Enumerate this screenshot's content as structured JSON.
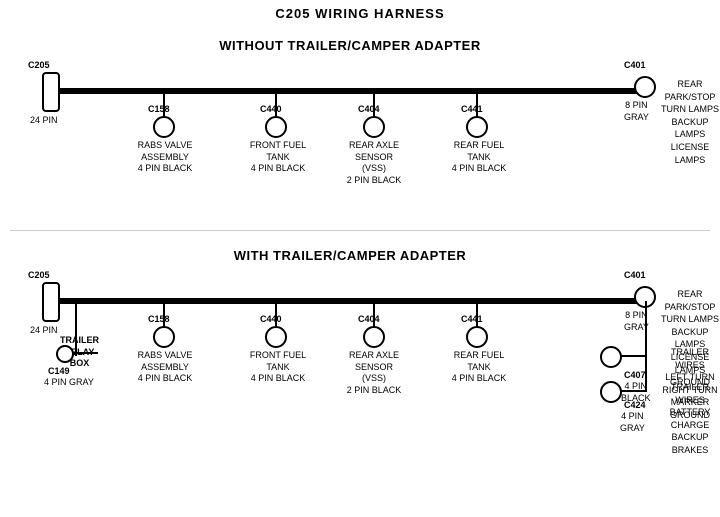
{
  "title": "C205 WIRING HARNESS",
  "section1": {
    "label": "WITHOUT  TRAILER/CAMPER  ADAPTER",
    "connectors": {
      "left": {
        "id": "C205",
        "sub": "24 PIN",
        "type": "rect"
      },
      "right": {
        "id": "C401",
        "sub": "8 PIN\nGRAY",
        "desc": "REAR PARK/STOP\nTURN LAMPS\nBACKUP LAMPS\nLICENSE LAMPS",
        "type": "circle"
      },
      "c158": {
        "id": "C158",
        "desc": "RABS VALVE\nASSEMBLY\n4 PIN BLACK"
      },
      "c440": {
        "id": "C440",
        "desc": "FRONT FUEL\nTANK\n4 PIN BLACK"
      },
      "c404": {
        "id": "C404",
        "desc": "REAR AXLE\nSENSOR\n(VSS)\n2 PIN BLACK"
      },
      "c441": {
        "id": "C441",
        "desc": "REAR FUEL\nTANK\n4 PIN BLACK"
      }
    }
  },
  "section2": {
    "label": "WITH  TRAILER/CAMPER  ADAPTER",
    "connectors": {
      "left": {
        "id": "C205",
        "sub": "24 PIN",
        "type": "rect"
      },
      "right": {
        "id": "C401",
        "sub": "8 PIN\nGRAY",
        "desc": "REAR PARK/STOP\nTURN LAMPS\nBACKUP LAMPS\nLICENSE LAMPS\nGROUND",
        "type": "circle"
      },
      "c158": {
        "id": "C158",
        "desc": "RABS VALVE\nASSEMBLY\n4 PIN BLACK"
      },
      "c440": {
        "id": "C440",
        "desc": "FRONT FUEL\nTANK\n4 PIN BLACK"
      },
      "c404": {
        "id": "C404",
        "desc": "REAR AXLE\nSENSOR\n(VSS)\n2 PIN BLACK"
      },
      "c441": {
        "id": "C441",
        "desc": "REAR FUEL\nTANK\n4 PIN BLACK"
      },
      "trailer_relay": "TRAILER\nRELAY\nBOX",
      "c149": {
        "id": "C149",
        "desc": "4 PIN GRAY"
      },
      "c407": {
        "id": "C407",
        "sub": "4 PIN\nBLACK",
        "desc": "TRAILER WIRES\nLEFT TURN\nRIGHT TURN\nMARKER\nGROUND"
      },
      "c424": {
        "id": "C424",
        "sub": "4 PIN\nGRAY",
        "desc": "TRAILER WIRES\nBATTERY CHARGE\nBACKUP\nBRAKES"
      }
    }
  }
}
